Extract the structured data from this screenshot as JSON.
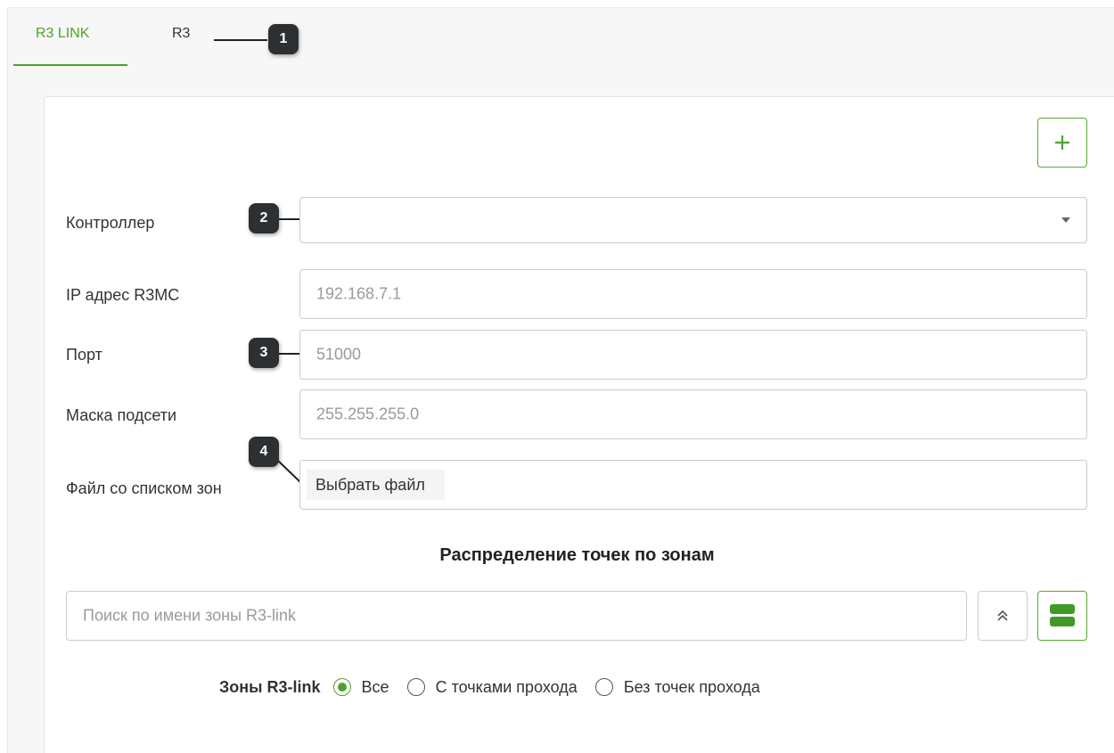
{
  "tabs": [
    {
      "label": "R3 LINK",
      "active": true
    },
    {
      "label": "R3",
      "active": false
    }
  ],
  "callouts": [
    "1",
    "2",
    "3",
    "4"
  ],
  "toolbar": {
    "add_icon": "plus-icon"
  },
  "form": {
    "controller": {
      "label": "Контроллер",
      "value": ""
    },
    "ip": {
      "label": "IP адрес R3MC",
      "placeholder": "192.168.7.1"
    },
    "port": {
      "label": "Порт",
      "placeholder": "51000"
    },
    "mask": {
      "label": "Маска подсети",
      "placeholder": "255.255.255.0"
    },
    "file": {
      "label": "Файл со списком зон",
      "button_label": "Выбрать файл"
    }
  },
  "zones": {
    "title": "Распределение точек по зонам",
    "search_placeholder": "Поиск по имени зоны R3-link",
    "collapse_icon": "double-chevron-up-icon",
    "view_icon": "layout-rows-icon",
    "filter": {
      "title": "Зоны R3-link",
      "options": [
        {
          "label": "Все",
          "checked": true
        },
        {
          "label": "С точками прохода",
          "checked": false
        },
        {
          "label": "Без точек прохода",
          "checked": false
        }
      ]
    }
  },
  "colors": {
    "accent": "#4fa12a",
    "badge_bg": "#2d3033"
  }
}
